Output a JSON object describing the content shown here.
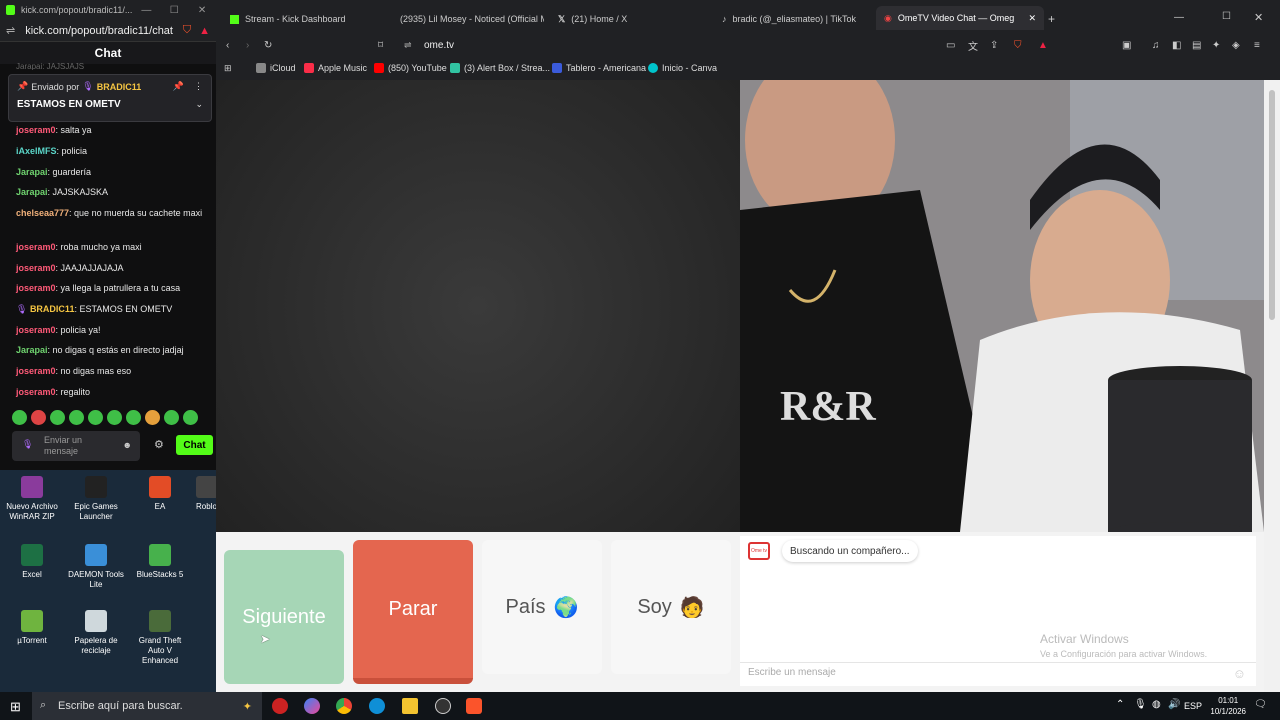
{
  "popout": {
    "tab_title": "kick.com/popout/bradic11/...",
    "url": "kick.com/popout/bradic11/chat",
    "chat_title": "Chat",
    "partial_top": "Jarapai: JAJSJAJS",
    "pinned": {
      "prefix": "Enviado por",
      "user": "BRADIC11",
      "message": "ESTAMOS EN OMETV"
    },
    "messages": [
      {
        "user": "joseram0",
        "text": ": salta ya",
        "color": "#ff5a78"
      },
      {
        "user": "iAxelMFS",
        "text": ": policia",
        "color": "#5bd6c9"
      },
      {
        "user": "Jarapai",
        "text": ": guardería",
        "color": "#6fd36f"
      },
      {
        "user": "Jarapai",
        "text": ": JAJSKAJSKA",
        "color": "#6fd36f"
      },
      {
        "user": "chelseaa777",
        "text": ": que no muerda su cachete maxi",
        "color": "#f0b07a"
      },
      {
        "user": "joseram0",
        "text": ": roba mucho ya maxi",
        "color": "#ff5a78"
      },
      {
        "user": "joseram0",
        "text": ": JAAJAJJAJAJA",
        "color": "#ff5a78"
      },
      {
        "user": "joseram0",
        "text": ": ya llega la patrullera a tu casa",
        "color": "#ff5a78"
      },
      {
        "user": "BRADIC11",
        "text": ": ESTAMOS EN OMETV",
        "color": "#f5c542"
      },
      {
        "user": "joseram0",
        "text": ": policia ya!",
        "color": "#ff5a78"
      },
      {
        "user": "Jarapai",
        "text": ": no digas q estás en directo jadjaj",
        "color": "#6fd36f"
      },
      {
        "user": "joseram0",
        "text": ": no digas mas eso",
        "color": "#ff5a78"
      },
      {
        "user": "joseram0",
        "text": ": regalito",
        "color": "#ff5a78"
      }
    ],
    "input_placeholder": "Enviar un mensaje",
    "send_label": "Chat"
  },
  "desktop": {
    "icons": [
      {
        "label": "Nuevo Archivo WinRAR ZIP",
        "color": "#8a3b9c"
      },
      {
        "label": "Epic Games Launcher",
        "color": "#222"
      },
      {
        "label": "EA",
        "color": "#e34c26"
      },
      {
        "label": "Roblo",
        "color": "#444"
      },
      {
        "label": "Excel",
        "color": "#1d7044"
      },
      {
        "label": "DAEMON Tools Lite",
        "color": "#3a8fd8"
      },
      {
        "label": "BlueStacks 5",
        "color": "#47b14c"
      },
      {
        "label": "µTorrent",
        "color": "#6fb43f"
      },
      {
        "label": "Papelera de reciclaje",
        "color": "#cfd8dc"
      },
      {
        "label": "Grand Theft Auto V Enhanced",
        "color": "#4a6b3a"
      }
    ]
  },
  "browser": {
    "tabs": [
      "Stream - Kick Dashboard",
      "(2935) Lil Mosey - Noticed (Official M",
      "(21) Home / X",
      "bradic (@_eliasmateo) | TikTok",
      "OmeTV Video Chat — Omeg"
    ],
    "url": "ome.tv",
    "bookmarks": [
      "iCloud",
      "Apple Music",
      "(850) YouTube",
      "(3) Alert Box / Strea...",
      "Tablero - Americana",
      "Inicio - Canva"
    ]
  },
  "ometv": {
    "buttons": {
      "next": "Siguiente",
      "stop": "Parar",
      "country": "País",
      "country_icon": "🌍",
      "soy": "Soy",
      "soy_icon": "🧑"
    },
    "logo_text": "Ome tv",
    "status": "Buscando un compañero...",
    "watermark_title": "Activar Windows",
    "watermark_sub": "Ve a Configuración para activar Windows.",
    "message_placeholder": "Escribe un mensaje"
  },
  "taskbar": {
    "search_placeholder": "Escribe aquí para buscar.",
    "lang": "ESP",
    "time": "01:01",
    "date": "10/1/2026"
  }
}
